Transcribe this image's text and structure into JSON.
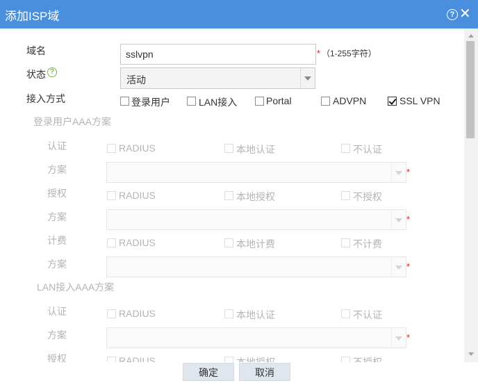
{
  "dialog": {
    "title": "添加ISP域"
  },
  "form": {
    "domain_name": {
      "label": "域名",
      "value": "sslvpn",
      "required_mark": "*",
      "hint": "（1-255字符）"
    },
    "status": {
      "label": "状态",
      "selected": "活动"
    },
    "access_mode": {
      "label": "接入方式",
      "options": [
        {
          "label": "登录用户",
          "checked": false
        },
        {
          "label": "LAN接入",
          "checked": false
        },
        {
          "label": "Portal",
          "checked": false
        },
        {
          "label": "ADVPN",
          "checked": false
        },
        {
          "label": "SSL VPN",
          "checked": true
        }
      ]
    },
    "login_aaa": {
      "title": "登录用户AAA方案",
      "rows": [
        {
          "label": "认证",
          "options": [
            "RADIUS",
            "本地认证",
            "不认证"
          ]
        },
        {
          "label": "方案",
          "required_mark": "*"
        },
        {
          "label": "授权",
          "options": [
            "RADIUS",
            "本地授权",
            "不授权"
          ]
        },
        {
          "label": "方案",
          "required_mark": "*"
        },
        {
          "label": "计费",
          "options": [
            "RADIUS",
            "本地计费",
            "不计费"
          ]
        },
        {
          "label": "方案",
          "required_mark": "*"
        }
      ]
    },
    "lan_aaa": {
      "title": "LAN接入AAA方案",
      "rows": [
        {
          "label": "认证",
          "options": [
            "RADIUS",
            "本地认证",
            "不认证"
          ]
        },
        {
          "label": "方案",
          "required_mark": "*"
        },
        {
          "label": "授权",
          "options": [
            "RADIUS",
            "本地授权",
            "不授权"
          ]
        }
      ]
    }
  },
  "footer": {
    "ok_label": "确定",
    "cancel_label": "取消"
  },
  "colors": {
    "titlebar": "#4a8fde",
    "required": "#e0201a",
    "status_icon": "#7ab648"
  }
}
